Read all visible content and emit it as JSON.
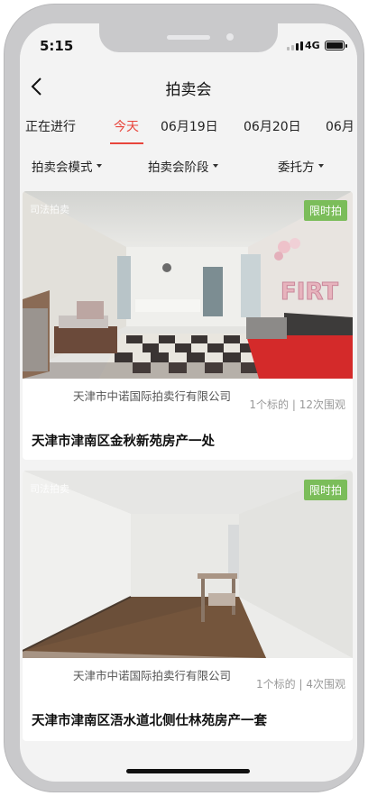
{
  "status_bar": {
    "time": "5:15",
    "network": "4G"
  },
  "header": {
    "title": "拍卖会"
  },
  "tabs": [
    {
      "label": "正在进行"
    },
    {
      "label": "今天"
    },
    {
      "label": "06月19日"
    },
    {
      "label": "06月20日"
    },
    {
      "label": "06月"
    }
  ],
  "active_tab": "今天",
  "filters": [
    {
      "label": "拍卖会模式"
    },
    {
      "label": "拍卖会阶段"
    },
    {
      "label": "委托方"
    }
  ],
  "listings": [
    {
      "badge_left": "司法拍卖",
      "badge_right": "限时拍",
      "auction_house": "天津市中诺国际拍卖行有限公司",
      "stats": "1个标的 | 12次围观",
      "title": "天津市津南区金秋新苑房产一处"
    },
    {
      "badge_left": "司法拍卖",
      "badge_right": "限时拍",
      "auction_house": "天津市中诺国际拍卖行有限公司",
      "stats": "1个标的 | 4次围观",
      "title": "天津市津南区浯水道北侧仕林苑房产一套"
    }
  ],
  "colors": {
    "accent": "#e8453c",
    "badge_green": "#7bbd5a"
  }
}
